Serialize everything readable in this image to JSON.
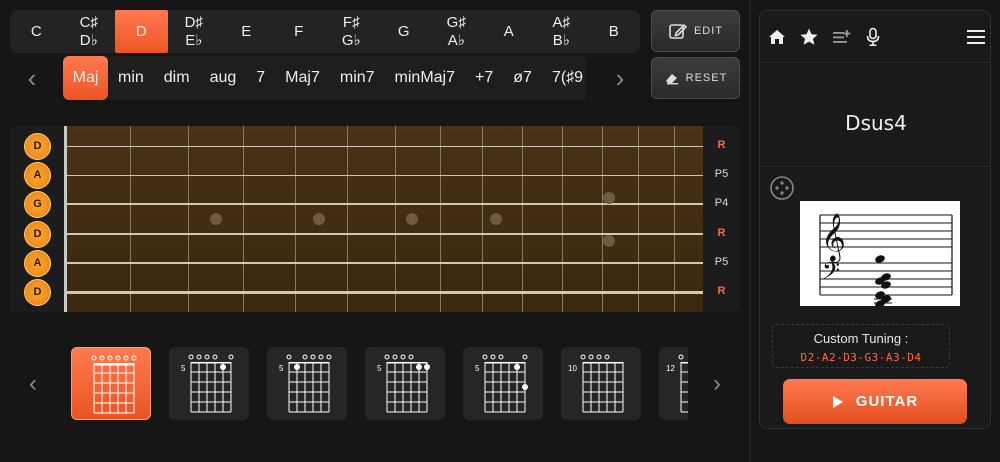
{
  "keys": [
    {
      "top": "C",
      "bottom": ""
    },
    {
      "top": "C♯",
      "bottom": "D♭"
    },
    {
      "top": "D",
      "bottom": ""
    },
    {
      "top": "D♯",
      "bottom": "E♭"
    },
    {
      "top": "E",
      "bottom": ""
    },
    {
      "top": "F",
      "bottom": ""
    },
    {
      "top": "F♯",
      "bottom": "G♭"
    },
    {
      "top": "G",
      "bottom": ""
    },
    {
      "top": "G♯",
      "bottom": "A♭"
    },
    {
      "top": "A",
      "bottom": ""
    },
    {
      "top": "A♯",
      "bottom": "B♭"
    },
    {
      "top": "B",
      "bottom": ""
    }
  ],
  "selected_key_index": 2,
  "qualities": [
    "Maj",
    "min",
    "dim",
    "aug",
    "7",
    "Maj7",
    "min7",
    "minMaj7",
    "+7",
    "ø7",
    "7(♯9"
  ],
  "selected_quality_index": 0,
  "toolbar": {
    "edit_label": "EDIT",
    "reset_label": "RESET"
  },
  "fretboard": {
    "open_notes": [
      "D",
      "A",
      "G",
      "D",
      "A",
      "D"
    ],
    "intervals": [
      "R",
      "P5",
      "P4",
      "R",
      "P5",
      "R"
    ],
    "root_color": "#ff6a3d",
    "note_color": "#f0901f"
  },
  "chord_shapes": [
    {
      "fret_label": "",
      "selected": true,
      "top": "oooooo"
    },
    {
      "fret_label": "5",
      "selected": false,
      "top": "oooo o"
    },
    {
      "fret_label": "5",
      "selected": false,
      "top": "o oooo"
    },
    {
      "fret_label": "5",
      "selected": false,
      "top": "oooo"
    },
    {
      "fret_label": "5",
      "selected": false,
      "top": "ooo  o"
    },
    {
      "fret_label": "10",
      "selected": false,
      "top": "oooo"
    },
    {
      "fret_label": "12",
      "selected": false,
      "top": "o"
    }
  ],
  "panel": {
    "icons": [
      "home-icon",
      "star-icon",
      "playlist-icon",
      "microphone-icon"
    ],
    "chord_name": "Dsus4",
    "tuning_label": "Custom Tuning :",
    "tuning_value": "D2-A2-D3-G3-A3-D4",
    "play_label": "GUITAR"
  },
  "colors": {
    "accent": "#ff6a3d",
    "background": "#161616"
  }
}
